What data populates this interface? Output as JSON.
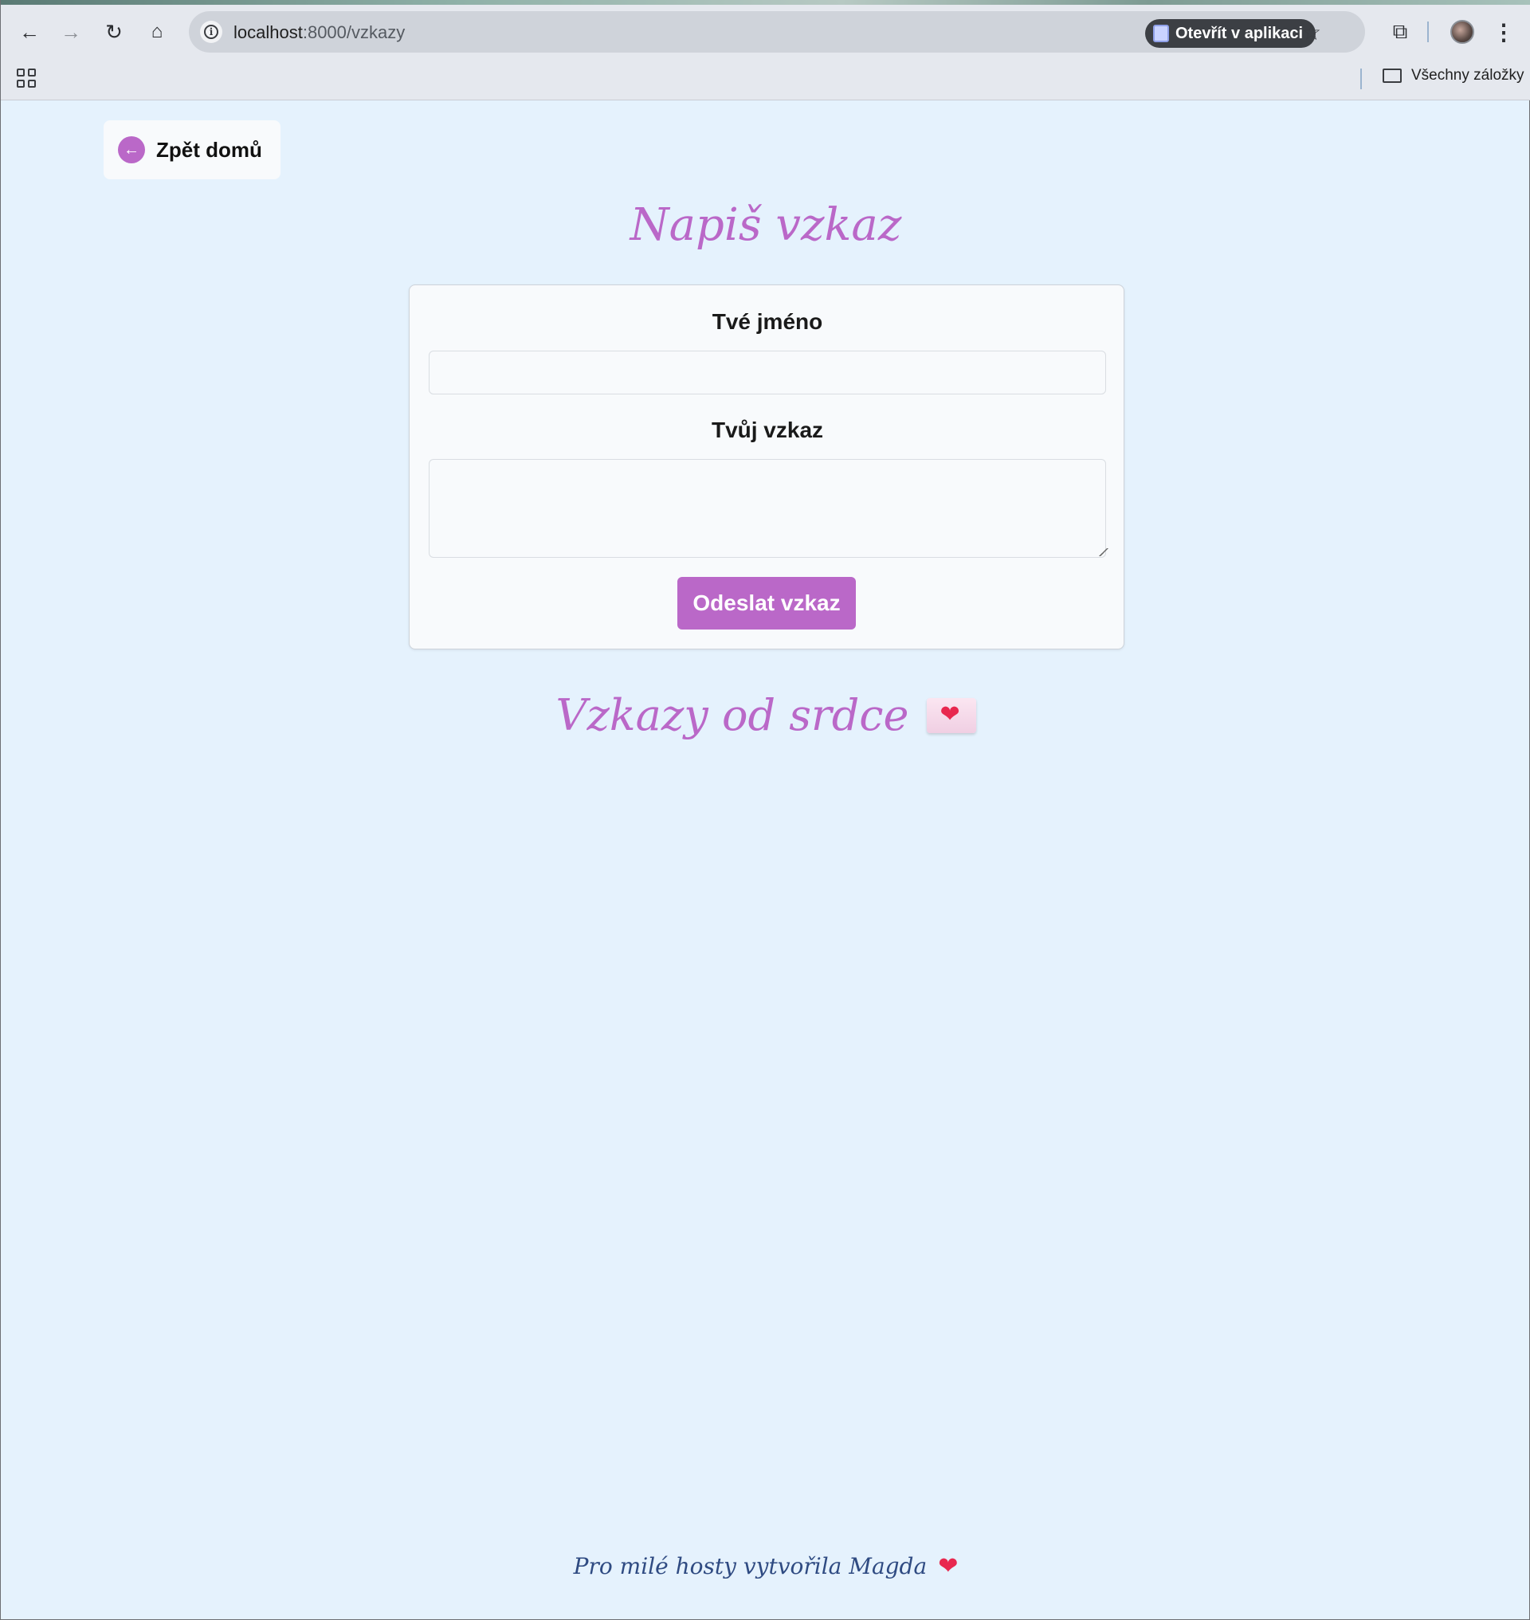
{
  "browser": {
    "url_host": "localhost",
    "url_path": ":8000/vzkazy",
    "open_in_app_label": "Otevřít v aplikaci",
    "all_bookmarks_label": "Všechny záložky"
  },
  "page": {
    "back_label": "Zpět domů",
    "form_title": "Napiš vzkaz",
    "name_label": "Tvé jméno",
    "name_value": "",
    "message_label": "Tvůj vzkaz",
    "message_value": "",
    "submit_label": "Odeslat vzkaz",
    "messages_title": "Vzkazy od srdce",
    "footer_text": "Pro milé hosty vytvořila Magda"
  },
  "icons": {
    "back": "arrow-left-icon",
    "envelope": "love-letter-icon",
    "footer": "heart-icon"
  },
  "colors": {
    "accent": "#ba68c8",
    "background": "#e5f2fd",
    "footer_text": "#2f4b82",
    "heart": "#e8284f"
  }
}
